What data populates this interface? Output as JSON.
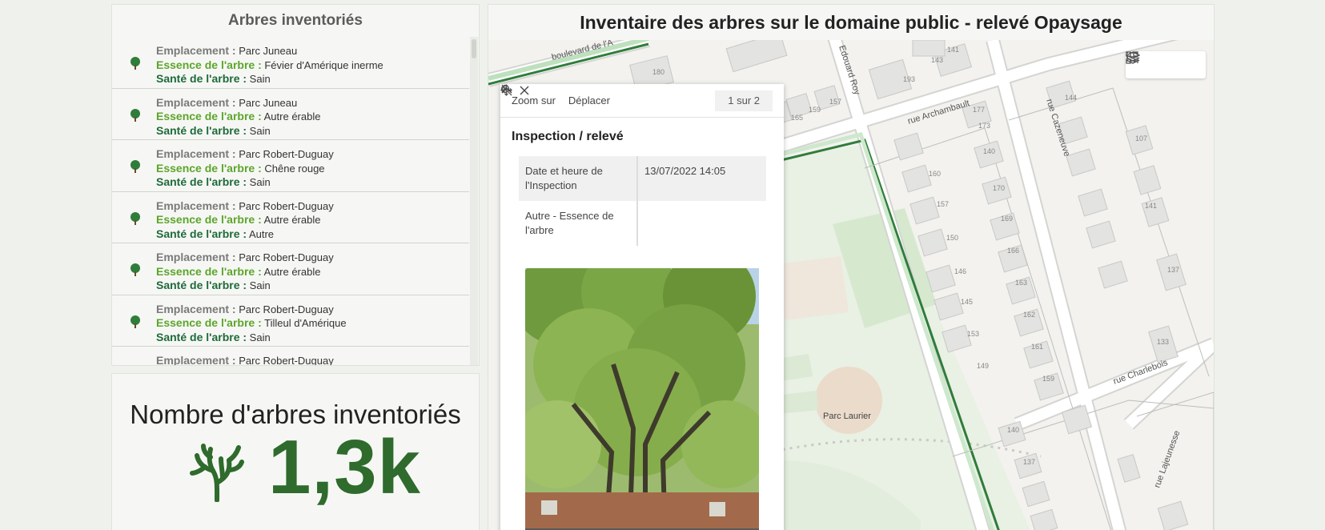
{
  "list_panel": {
    "title": "Arbres inventoriés",
    "labels": {
      "location": "Emplacement :",
      "species": "Essence de l'arbre :",
      "health": "Santé de l'arbre :"
    },
    "items": [
      {
        "location": "Parc Juneau",
        "species": "Févier d'Amérique inerme",
        "health": "Sain"
      },
      {
        "location": "Parc Juneau",
        "species": "Autre érable",
        "health": "Sain"
      },
      {
        "location": "Parc Robert-Duguay",
        "species": "Chêne rouge",
        "health": "Sain"
      },
      {
        "location": "Parc Robert-Duguay",
        "species": "Autre érable",
        "health": "Autre"
      },
      {
        "location": "Parc Robert-Duguay",
        "species": "Autre érable",
        "health": "Sain"
      },
      {
        "location": "Parc Robert-Duguay",
        "species": "Tilleul d'Amérique",
        "health": "Sain"
      },
      {
        "location": "Parc Robert-Duguay",
        "species": "",
        "health": ""
      }
    ],
    "icon": "tree-icon"
  },
  "count_panel": {
    "title": "Nombre d'arbres inventoriés",
    "value": "1,3k",
    "icon": "coral-tree-icon"
  },
  "map_panel": {
    "title": "Inventaire des arbres sur le domaine public - relevé Opaysage",
    "tools": [
      "list-icon",
      "layers-icon",
      "qr-icon"
    ],
    "labels": {
      "boulevard": "boulevard de l'A",
      "edouard_roy": "Edouard Roy",
      "archambault": "rue Archambault",
      "cazeneuve": "rue Cazeneuve",
      "charlebois": "rue Charlebois",
      "lajeunesse": "rue Lajeunesse",
      "parc": "Parc Laurier"
    },
    "house_numbers": [
      "180",
      "193",
      "143",
      "141",
      "165",
      "159",
      "157",
      "177",
      "140",
      "173",
      "170",
      "169",
      "166",
      "163",
      "162",
      "161",
      "159",
      "160",
      "157",
      "150",
      "146",
      "145",
      "153",
      "149",
      "144",
      "107",
      "141",
      "137",
      "133",
      "140",
      "137"
    ]
  },
  "popup": {
    "zoom_label": "Zoom sur",
    "move_label": "Déplacer",
    "pager_label": "1 sur 2",
    "title": "Inspection / relevé",
    "rows": [
      {
        "key": "Date et heure de l'Inspection",
        "value": "13/07/2022 14:05"
      },
      {
        "key": "Autre - Essence de l'arbre",
        "value": ""
      }
    ]
  },
  "colors": {
    "accent_green": "#5da52b",
    "dark_green": "#1f6a3b",
    "count_green": "#2e6b2c"
  }
}
